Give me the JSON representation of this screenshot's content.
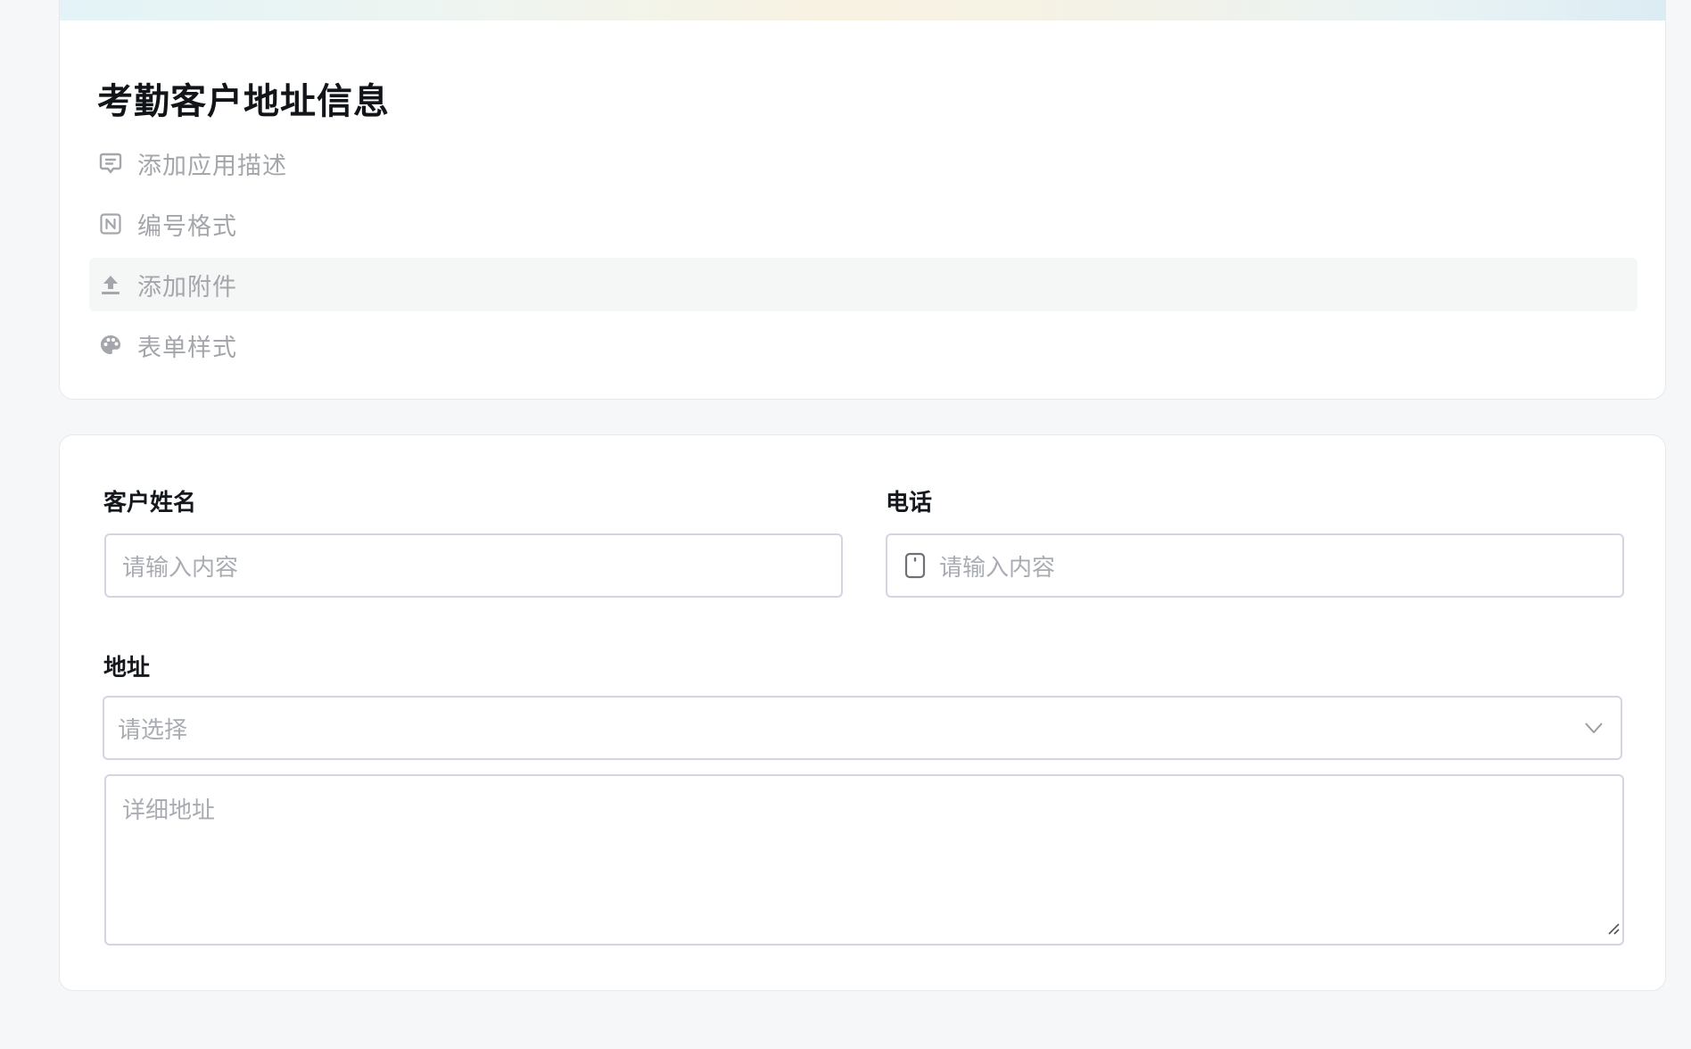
{
  "app": {
    "title": "考勤客户地址信息"
  },
  "menu": [
    {
      "icon": "comment-icon",
      "label": "添加应用描述"
    },
    {
      "icon": "numbering-icon",
      "label": "编号格式"
    },
    {
      "icon": "upload-icon",
      "label": "添加附件"
    },
    {
      "icon": "palette-icon",
      "label": "表单样式"
    }
  ],
  "form": {
    "customer_name": {
      "label": "客户姓名",
      "placeholder": "请输入内容"
    },
    "phone": {
      "label": "电话",
      "placeholder": "请输入内容"
    },
    "address": {
      "label": "地址",
      "select_placeholder": "请选择",
      "detail_placeholder": "详细地址"
    }
  },
  "colors": {
    "page_bg": "#f6f7f9",
    "card_bg": "#ffffff",
    "muted_text": "#a3a6ab",
    "border": "#d3d5e3"
  }
}
